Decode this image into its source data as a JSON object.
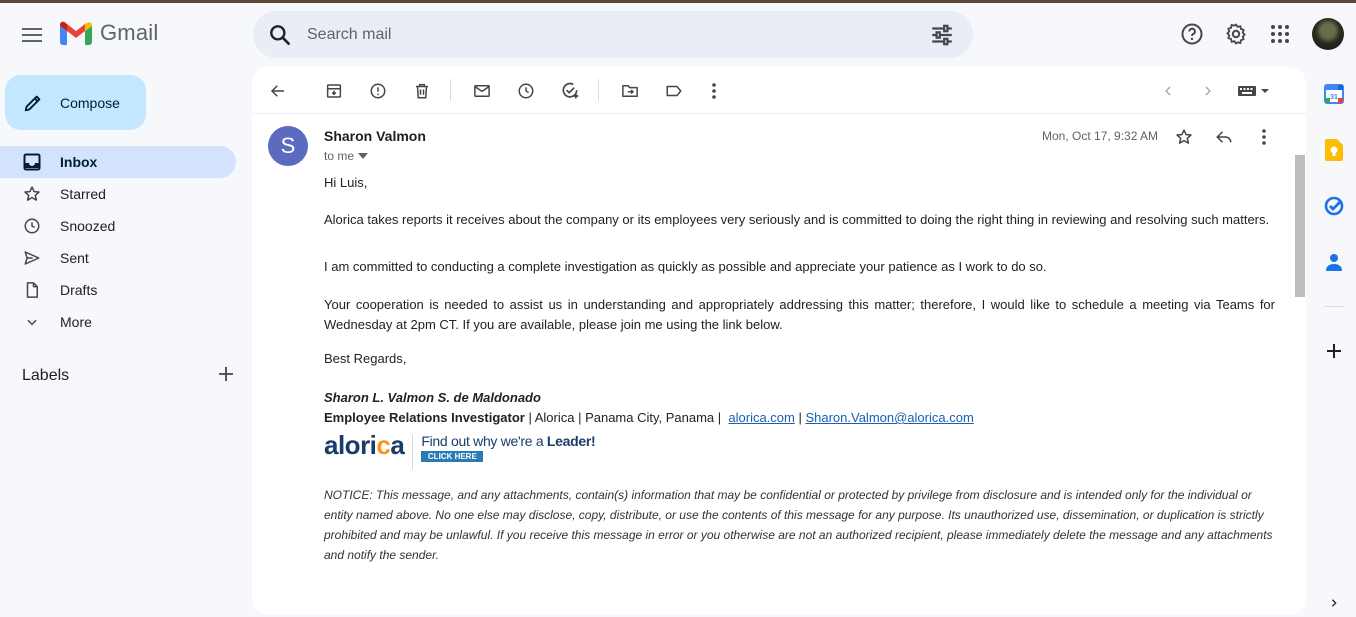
{
  "app": {
    "name": "Gmail"
  },
  "search": {
    "placeholder": "Search mail"
  },
  "sidebar": {
    "compose_label": "Compose",
    "items": [
      {
        "label": "Inbox",
        "icon": "inbox-icon",
        "active": true
      },
      {
        "label": "Starred",
        "icon": "star-icon"
      },
      {
        "label": "Snoozed",
        "icon": "clock-icon"
      },
      {
        "label": "Sent",
        "icon": "send-icon"
      },
      {
        "label": "Drafts",
        "icon": "draft-icon"
      },
      {
        "label": "More",
        "icon": "chevron-down-icon"
      }
    ],
    "labels_title": "Labels"
  },
  "message": {
    "sender_initial": "S",
    "sender_name": "Sharon Valmon",
    "to_label": "to me",
    "date": "Mon, Oct 17, 9:32 AM",
    "greeting": "Hi Luis,",
    "para1": "Alorica takes reports it receives about the company or its employees very seriously and is committed to doing the right thing in reviewing and resolving such matters.",
    "para2": "I am committed to conducting a complete investigation as quickly as possible and appreciate your patience as I work to do so.",
    "para3": "Your cooperation is needed to assist us in understanding and appropriately addressing this matter; therefore, I would like to schedule a meeting via Teams for Wednesday at 2pm CT. If you are available, please join me using the link below.",
    "closing": "Best Regards,",
    "signature": {
      "name": "Sharon L. Valmon S. de Maldonado",
      "title": "Employee Relations Investigator",
      "details": " | Alorica | Panama City, Panama | ",
      "website": "alorica.com",
      "separator": " | ",
      "email": "Sharon.Valmon@alorica.com"
    },
    "banner": {
      "logo_text_1": "alori",
      "logo_text_2": "c",
      "logo_text_3": "a",
      "tagline": "Find out why we're a ",
      "tagline_bold": "Leader!",
      "button": "CLICK HERE"
    },
    "notice": "NOTICE: This message, and any attachments, contain(s) information that may be confidential or protected by privilege from disclosure and is intended only for the individual or entity named above. No one else may disclose, copy, distribute, or use the contents of this message for any purpose. Its unauthorized use, dissemination, or duplication is strictly prohibited and may be unlawful. If you receive this message in error or you otherwise are not an authorized recipient, please immediately delete the message and any attachments and notify the sender."
  },
  "colors": {
    "accent": "#0b57d0",
    "compose_bg": "#c2e7ff",
    "active_nav_bg": "#d3e3fd",
    "avatar_bg": "#5c6bc0"
  }
}
